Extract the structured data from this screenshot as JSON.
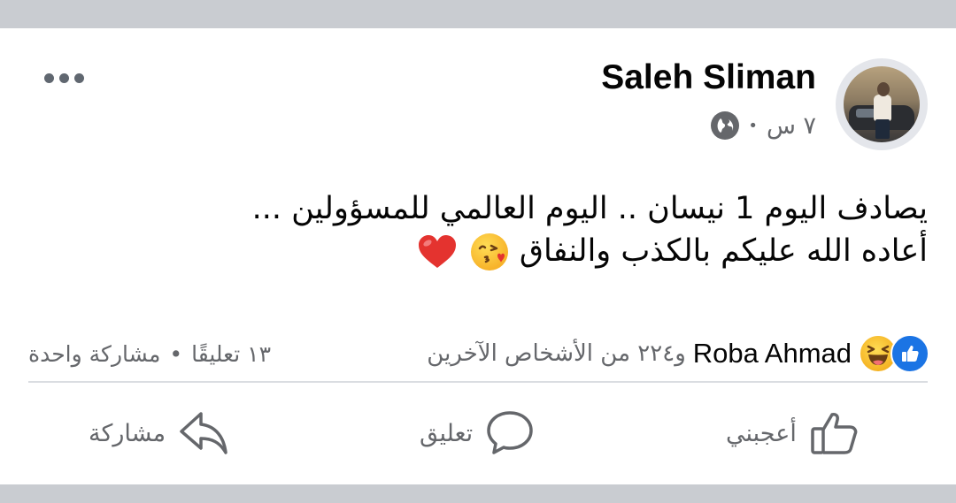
{
  "post": {
    "author": "Saleh Sliman",
    "time": "٧ س",
    "separator": "•",
    "text_line1": "يصادف اليوم 1 نيسان .. اليوم العالمي للمسؤولين ...",
    "text_line2": "أعاده الله عليكم بالكذب والنفاق",
    "emoji_after_text": [
      "kissing-face-emoji",
      "red-heart-emoji"
    ],
    "privacy_icon": "globe-icon",
    "more_icon": "more-dots-icon"
  },
  "stats": {
    "reactor_name": "Roba Ahmad",
    "reactor_rest": "و٢٢٤ من الأشخاص الآخرين",
    "comments": "١٣ تعليقًا",
    "dot": "•",
    "shares": "مشاركة واحدة",
    "reaction_icons": [
      "like-icon",
      "haha-icon"
    ]
  },
  "actions": {
    "like": "أعجبني",
    "comment": "تعليق",
    "share": "مشاركة"
  },
  "colors": {
    "background": "#c9ccd1",
    "card": "#ffffff",
    "text_primary": "#050505",
    "text_secondary": "#65676b",
    "like_blue": "#1b74e4",
    "heart_red": "#e4332f"
  }
}
